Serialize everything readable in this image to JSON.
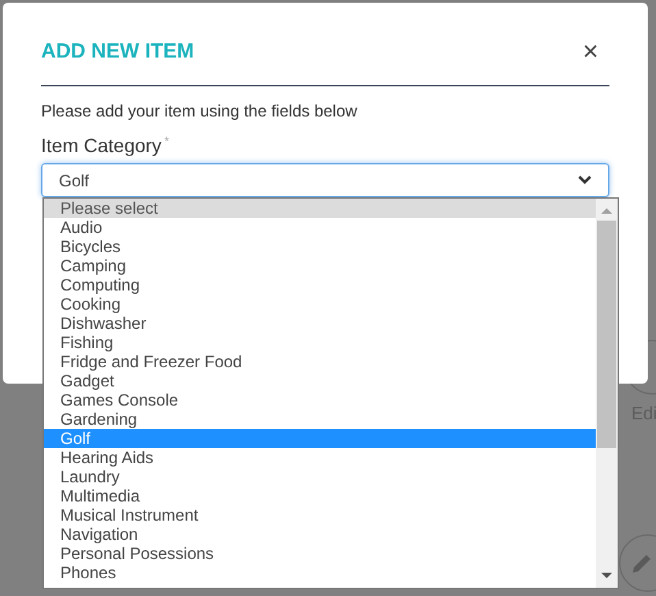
{
  "dialog": {
    "title": "ADD NEW ITEM",
    "close": "×",
    "intro": "Please add your item using the fields below",
    "field": {
      "label": "Item Category",
      "required_mark": "*",
      "value": "Golf",
      "open": true
    }
  },
  "options": [
    {
      "label": "Please select",
      "selected": false,
      "kind": "placeholder"
    },
    {
      "label": "Audio",
      "selected": false,
      "kind": "option"
    },
    {
      "label": "Bicycles",
      "selected": false,
      "kind": "option"
    },
    {
      "label": "Camping",
      "selected": false,
      "kind": "option"
    },
    {
      "label": "Computing",
      "selected": false,
      "kind": "option"
    },
    {
      "label": "Cooking",
      "selected": false,
      "kind": "option"
    },
    {
      "label": "Dishwasher",
      "selected": false,
      "kind": "option"
    },
    {
      "label": "Fishing",
      "selected": false,
      "kind": "option"
    },
    {
      "label": "Fridge and Freezer Food",
      "selected": false,
      "kind": "option"
    },
    {
      "label": "Gadget",
      "selected": false,
      "kind": "option"
    },
    {
      "label": "Games Console",
      "selected": false,
      "kind": "option"
    },
    {
      "label": "Gardening",
      "selected": false,
      "kind": "option"
    },
    {
      "label": "Golf",
      "selected": true,
      "kind": "option"
    },
    {
      "label": "Hearing Aids",
      "selected": false,
      "kind": "option"
    },
    {
      "label": "Laundry",
      "selected": false,
      "kind": "option"
    },
    {
      "label": "Multimedia",
      "selected": false,
      "kind": "option"
    },
    {
      "label": "Musical Instrument",
      "selected": false,
      "kind": "option"
    },
    {
      "label": "Navigation",
      "selected": false,
      "kind": "option"
    },
    {
      "label": "Personal Posessions",
      "selected": false,
      "kind": "option"
    },
    {
      "label": "Phones",
      "selected": false,
      "kind": "option"
    }
  ],
  "background": {
    "edit_label": "Edi"
  }
}
